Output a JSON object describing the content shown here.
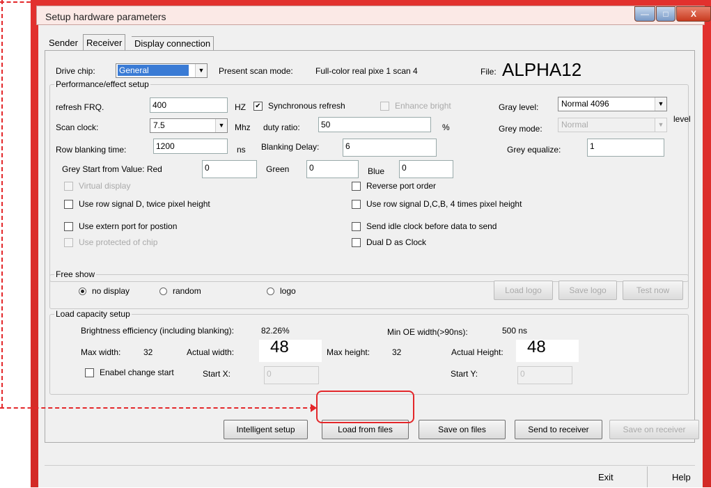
{
  "window": {
    "title": "Setup hardware parameters",
    "controls": {
      "minimize": "—",
      "maximize": "□",
      "close": "X"
    }
  },
  "tabs": [
    {
      "label": "Sender"
    },
    {
      "label": "Receiver",
      "active": true
    },
    {
      "label": "Display connection"
    }
  ],
  "top": {
    "drive_chip_label": "Drive chip:",
    "drive_chip_value": "General",
    "scan_mode_label": "Present scan mode:",
    "scan_mode_value": "Full-color real pixe 1 scan 4",
    "file_label": "File:",
    "file_value": "ALPHA12"
  },
  "performance": {
    "title": "Performance/effect setup",
    "refresh_label": "refresh FRQ.",
    "refresh_value": "400",
    "refresh_unit": "HZ",
    "sync_refresh_label": "Synchronous refresh",
    "enhance_bright_label": "Enhance bright",
    "gray_level_label": "Gray level:",
    "gray_level_value": "Normal 4096",
    "level_label": "level",
    "scan_clock_label": "Scan clock:",
    "scan_clock_value": "7.5",
    "scan_clock_unit": "Mhz",
    "duty_ratio_label": "duty ratio:",
    "duty_ratio_value": "50",
    "duty_ratio_unit": "%",
    "grey_mode_label": "Grey mode:",
    "grey_mode_value": "Normal",
    "row_blanking_label": "Row blanking time:",
    "row_blanking_value": "1200",
    "row_blanking_unit": "ns",
    "blanking_delay_label": "Blanking Delay:",
    "blanking_delay_value": "6",
    "grey_equalize_label": "Grey equalize:",
    "grey_equalize_value": "1",
    "grey_start_label": "Grey Start from Value:  Red",
    "red_value": "0",
    "green_label": "Green",
    "green_value": "0",
    "blue_label": "Blue",
    "blue_value": "0",
    "virtual_display_label": "Virtual display",
    "reverse_port_label": "Reverse port order",
    "row_signal_d_label": "Use row signal D, twice pixel height",
    "row_signal_dcb_label": "Use row signal D,C,B, 4 times pixel height",
    "extern_port_label": "Use extern port for postion",
    "idle_clock_label": "Send idle clock before data to send",
    "protected_chip_label": "Use protected of chip",
    "dual_d_label": "Dual D as Clock"
  },
  "free_show": {
    "title": "Free show",
    "no_display": "no display",
    "random": "random",
    "logo": "logo",
    "load_logo": "Load logo",
    "save_logo": "Save logo",
    "test_now": "Test now"
  },
  "load_capacity": {
    "title": "Load capacity setup",
    "brightness_label": "Brightness efficiency (including blanking):",
    "brightness_value": "82.26%",
    "min_oe_label": "Min OE width(>90ns):",
    "min_oe_value": "500 ns",
    "max_width_label": "Max width:",
    "max_width_value": "32",
    "actual_width_label": "Actual width:",
    "actual_width_value": "48",
    "max_height_label": "Max height:",
    "max_height_value": "32",
    "actual_height_label": "Actual Height:",
    "actual_height_value": "48",
    "change_start_label": "Enabel change start",
    "start_x_label": "Start X:",
    "start_x_value": "0",
    "start_y_label": "Start Y:",
    "start_y_value": "0"
  },
  "actions": {
    "intelligent_setup": "Intelligent setup",
    "load_from_files": "Load from files",
    "save_on_files": "Save on files",
    "send_to_receiver": "Send to receiver",
    "save_on_receiver": "Save on receiver"
  },
  "footer": {
    "exit": "Exit",
    "help": "Help"
  },
  "colors": {
    "frame": "#d32b27",
    "annotation": "#e3272a",
    "selected_combo": "#3a7bd5"
  }
}
